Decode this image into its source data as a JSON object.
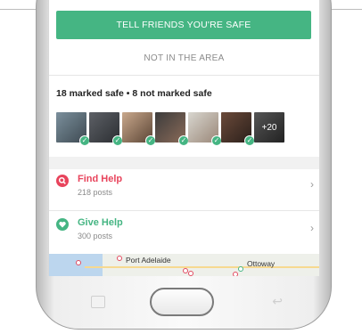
{
  "actions": {
    "tell_friends_label": "TELL FRIENDS YOU'RE SAFE",
    "not_in_area_label": "NOT IN THE AREA"
  },
  "summary": {
    "text": "18 marked safe • 8 not marked safe"
  },
  "friends": {
    "more_badge": "+20"
  },
  "rows": [
    {
      "title": "Find Help",
      "subtitle": "218 posts",
      "color": "#e8445c",
      "icon": "search-icon"
    },
    {
      "title": "Give Help",
      "subtitle": "300 posts",
      "color": "#45b583",
      "icon": "heart-icon"
    }
  ],
  "map": {
    "label1": "Port Adelaide",
    "label2": "Ottoway"
  },
  "colors": {
    "accent": "#45b583",
    "find_help": "#e8445c"
  }
}
